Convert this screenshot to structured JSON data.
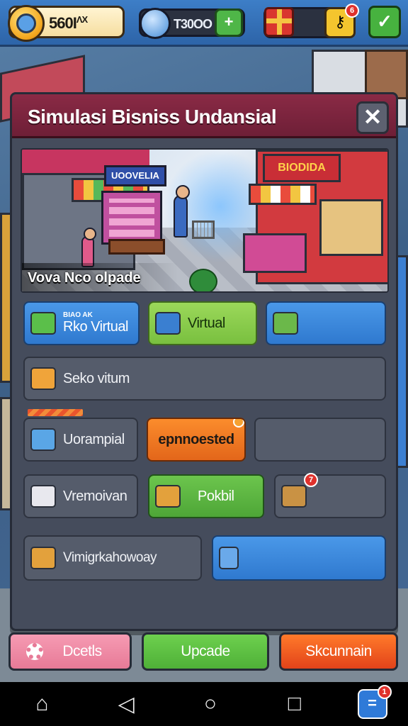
{
  "topbar": {
    "coins": "560I",
    "coins_suffix": "ΛX",
    "gems": "T30OO",
    "gems_add": "+",
    "gift_badge": "",
    "key_badge": "6",
    "confirm_icon": "✓"
  },
  "dialog": {
    "title": "Simulasi Bisniss Undansial",
    "close_label": "✕",
    "hero": {
      "left_sign": "UOOVELIA",
      "right_sign": "BIODIDA",
      "caption": "Vova Nco olpade"
    },
    "tiles": {
      "row1": [
        {
          "label": "Rko Virtual",
          "note": "BIAO AK",
          "icon": "cube-icon"
        },
        {
          "label": "Virtual",
          "icon": "basket-icon"
        },
        {
          "label": "",
          "icon": "produce-crate-icon"
        }
      ],
      "row2": {
        "label": "Seko vitum",
        "icon": "box-icon"
      },
      "row3": [
        {
          "label": "Uorampial",
          "icon": "server-icon"
        },
        {
          "label": "epnnoested",
          "icon": "",
          "badge": ""
        },
        {
          "label": "",
          "icon": ""
        }
      ],
      "row4": [
        {
          "label": "Vremoivan",
          "icon": "dice-icon"
        },
        {
          "label": "Pokbil",
          "icon": "package-icon"
        },
        {
          "label": "",
          "icon": "crate-icon",
          "badge": "7"
        }
      ],
      "row5": [
        {
          "label": "Vimigrkahowoay",
          "icon": "store-box-icon"
        },
        {
          "label": "",
          "icon": "cart-icon"
        }
      ]
    },
    "actions": {
      "details": "Dcetls",
      "upgrade": "Upcade",
      "special": "Skcunnain"
    }
  },
  "navbar": {
    "home": "⌂",
    "back": "◁",
    "circle": "○",
    "square": "□",
    "app_badge": "1"
  },
  "colors": {
    "header": "#7a2440",
    "panel": "#454c5c",
    "blue": "#3a89dc",
    "green": "#79c03f",
    "orange": "#f07a24",
    "topbar": "#3573b8"
  }
}
